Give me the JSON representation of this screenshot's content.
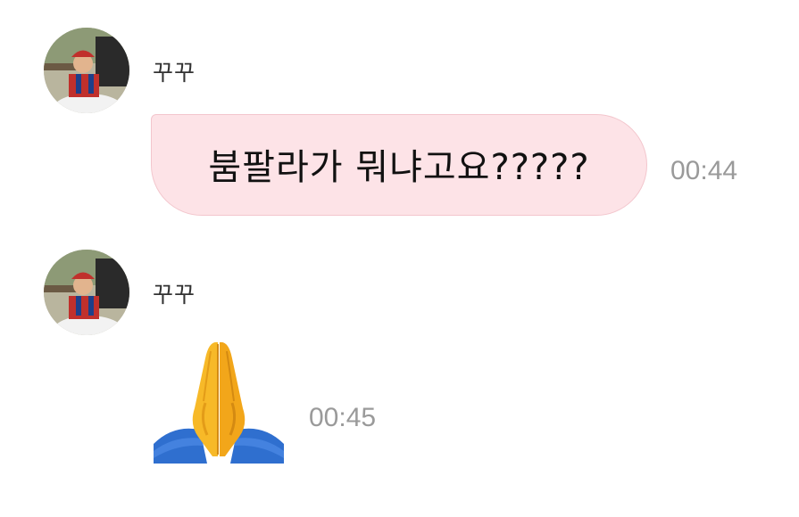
{
  "messages": [
    {
      "sender": "꾸꾸",
      "text": "붐팔라가 뭐냐고요?????",
      "time": "00:44"
    },
    {
      "sender": "꾸꾸",
      "emoji": "folded-hands",
      "time": "00:45"
    }
  ],
  "colors": {
    "bubble_bg": "#fde3e7",
    "bubble_border": "#f3c6cd",
    "time_text": "#9a9a9a",
    "sender_text": "#333333"
  }
}
